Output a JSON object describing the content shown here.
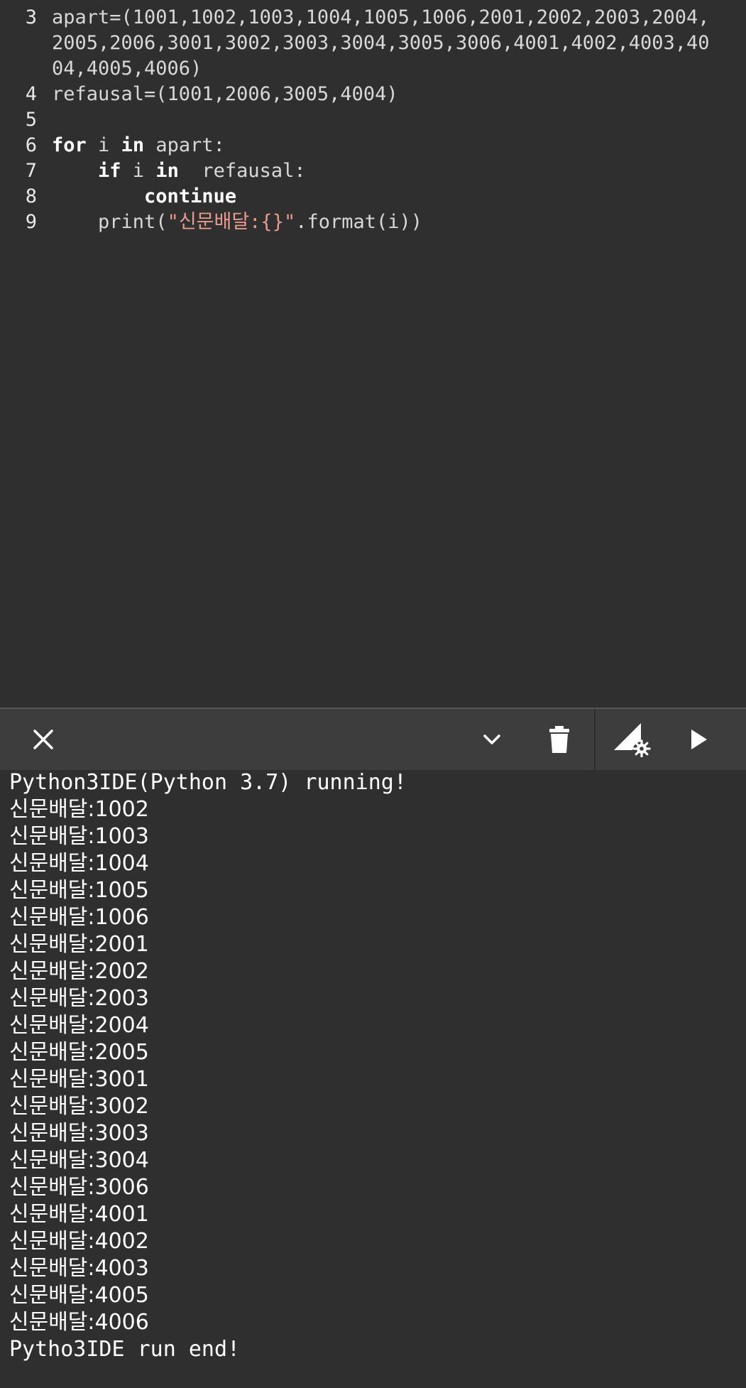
{
  "editor": {
    "lines": [
      {
        "num": "3",
        "parts": [
          {
            "t": "apart=(1001,1002,1003,1004,1005,1006,2001,2002,2003,2004,",
            "k": "plain"
          }
        ]
      },
      {
        "num": "",
        "parts": [
          {
            "t": "2005,2006,3001,3002,3003,3004,3005,3006,4001,4002,4003,40",
            "k": "plain"
          }
        ]
      },
      {
        "num": "",
        "parts": [
          {
            "t": "04,4005,4006)",
            "k": "plain"
          }
        ]
      },
      {
        "num": "4",
        "parts": [
          {
            "t": "refausal=(1001,2006,3005,4004)",
            "k": "plain"
          }
        ]
      },
      {
        "num": "5",
        "parts": []
      },
      {
        "num": "6",
        "parts": [
          {
            "t": "for",
            "k": "kw"
          },
          {
            "t": " i ",
            "k": "plain"
          },
          {
            "t": "in",
            "k": "kw"
          },
          {
            "t": " apart:",
            "k": "plain"
          }
        ]
      },
      {
        "num": "7",
        "parts": [
          {
            "t": "    ",
            "k": "plain"
          },
          {
            "t": "if",
            "k": "kw"
          },
          {
            "t": " i ",
            "k": "plain"
          },
          {
            "t": "in",
            "k": "kw"
          },
          {
            "t": "  refausal:",
            "k": "plain"
          }
        ]
      },
      {
        "num": "8",
        "parts": [
          {
            "t": "        ",
            "k": "plain"
          },
          {
            "t": "continue",
            "k": "kw"
          }
        ]
      },
      {
        "num": "9",
        "parts": [
          {
            "t": "    print(",
            "k": "plain"
          },
          {
            "t": "\"신문배달:{}\"",
            "k": "str"
          },
          {
            "t": ".format(i))",
            "k": "plain"
          }
        ]
      }
    ]
  },
  "toolbar": {
    "close_icon": "close-icon",
    "collapse_icon": "chevron-down-icon",
    "clear_icon": "trash-icon",
    "settings_icon": "signal-settings-icon",
    "run_icon": "play-icon"
  },
  "console": {
    "header": "Python3IDE(Python 3.7) running!",
    "outputs": [
      "신문배달:1002",
      "신문배달:1003",
      "신문배달:1004",
      "신문배달:1005",
      "신문배달:1006",
      "신문배달:2001",
      "신문배달:2002",
      "신문배달:2003",
      "신문배달:2004",
      "신문배달:2005",
      "신문배달:3001",
      "신문배달:3002",
      "신문배달:3003",
      "신문배달:3004",
      "신문배달:3006",
      "신문배달:4001",
      "신문배달:4002",
      "신문배달:4003",
      "신문배달:4005",
      "신문배달:4006"
    ],
    "footer": "Pytho3IDE run end!"
  }
}
